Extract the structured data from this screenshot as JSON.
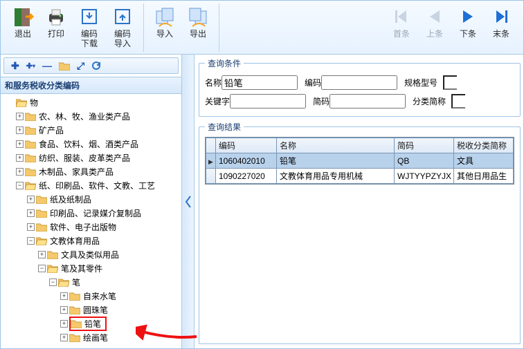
{
  "toolbar": {
    "exit": "退出",
    "print": "打印",
    "code_dl": "编码\n下载",
    "code_imp": "编码\n导入",
    "import": "导入",
    "export": "导出",
    "first": "首条",
    "prev": "上条",
    "next": "下条",
    "last": "末条"
  },
  "left": {
    "title": "和服务税收分类编码",
    "root": "物",
    "nodes": [
      "农、林、牧、渔业类产品",
      "矿产品",
      "食品、饮料、烟、酒类产品",
      "纺织、服装、皮革类产品",
      "木制品、家具类产品",
      "纸、印刷品、软件、文教、工艺",
      "纸及纸制品",
      "印刷品、记录媒介复制品",
      "软件、电子出版物",
      "文教体育用品"
    ],
    "sub1": "文具及类似用品",
    "sub2": "笔及其零件",
    "sub3": "笔",
    "leaves": [
      "自来水笔",
      "圆珠笔",
      "铅笔",
      "绘画笔"
    ]
  },
  "query": {
    "legend": "查询条件",
    "name_lbl": "名称",
    "name_val": "铅笔",
    "code_lbl": "编码",
    "code_val": "",
    "spec_lbl": "规格型号",
    "spec_val": "",
    "kw_lbl": "关键字",
    "kw_val": "",
    "short_lbl": "简码",
    "short_val": "",
    "cat_lbl": "分类简称",
    "cat_val": ""
  },
  "result": {
    "legend": "查询结果",
    "headers": [
      "编码",
      "名称",
      "简码",
      "税收分类简称"
    ],
    "rows": [
      {
        "sel": true,
        "cells": [
          "1060402010",
          "铅笔",
          "QB",
          "文具"
        ]
      },
      {
        "sel": false,
        "cells": [
          "1090227020",
          "文教体育用品专用机械",
          "WJTYYPZYJX",
          "其他日用品生"
        ]
      }
    ]
  }
}
